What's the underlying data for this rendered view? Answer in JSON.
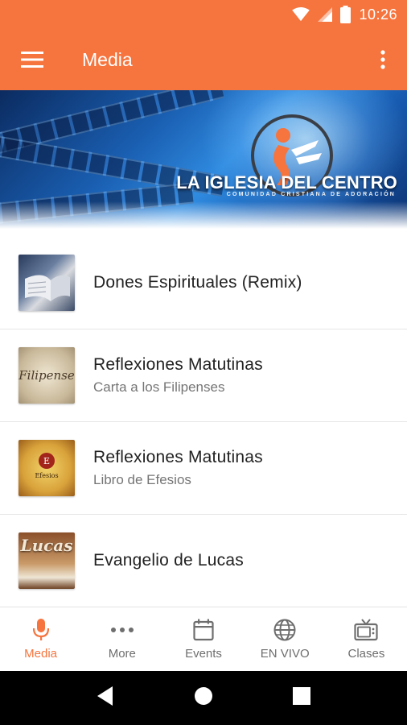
{
  "status_bar": {
    "time": "10:26"
  },
  "app_bar": {
    "title": "Media"
  },
  "banner": {
    "title": "LA IGLESIA DEL CENTRO",
    "subtitle": "COMUNIDAD CRISTIANA DE ADORACIÓN"
  },
  "media_items": [
    {
      "title": "Dones Espirituales (Remix)",
      "subtitle": "",
      "thumb_text": ""
    },
    {
      "title": "Reflexiones Matutinas",
      "subtitle": "Carta a los Filipenses",
      "thumb_text": "Filipense"
    },
    {
      "title": "Reflexiones Matutinas",
      "subtitle": "Libro de Efesios",
      "thumb_text": "Efesios"
    },
    {
      "title": "Evangelio de Lucas",
      "subtitle": "",
      "thumb_text": "Lucas"
    }
  ],
  "bottom_nav": [
    {
      "label": "Media",
      "icon": "microphone-icon",
      "active": true
    },
    {
      "label": "More",
      "icon": "more-dots-icon",
      "active": false
    },
    {
      "label": "Events",
      "icon": "calendar-icon",
      "active": false
    },
    {
      "label": "EN VIVO",
      "icon": "globe-icon",
      "active": false
    },
    {
      "label": "Clases",
      "icon": "tv-icon",
      "active": false
    }
  ],
  "colors": {
    "primary": "#f6743d",
    "text_primary": "#222222",
    "text_secondary": "#757575",
    "nav_inactive": "#6e6e6e"
  }
}
